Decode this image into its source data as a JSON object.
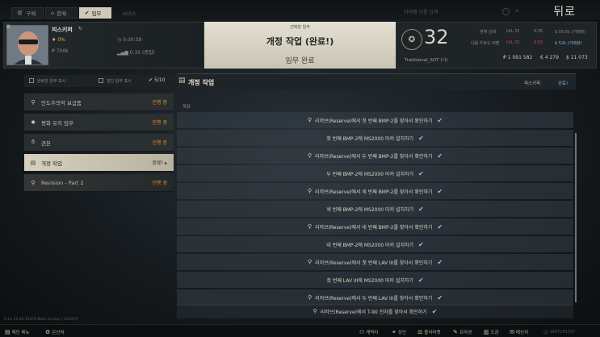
{
  "nav": {
    "tabs": [
      {
        "label": "구매",
        "icon": "cart-icon"
      },
      {
        "label": "판매",
        "icon": "tag-icon"
      },
      {
        "label": "임무",
        "icon": "check-icon"
      },
      {
        "label": "서비스",
        "icon": ""
      }
    ],
    "search_placeholder": "아이템 이름 검색",
    "back_label": "뒤로"
  },
  "profile": {
    "name": "피스키퍼",
    "standing": "0%",
    "spent": "₽ 700k",
    "time": "0:30:39",
    "rep": "0.35 (중립)"
  },
  "quest_header": {
    "selected_label": "선택한 임무",
    "title": "개정 작업 (완료!)",
    "status": "임무 완료"
  },
  "trader": {
    "level": "32",
    "name": "Traditional_SOT (나)",
    "current_label": "현재 상태",
    "next_label": "다음 우호도 레벨",
    "cur_lvl": "LVL 32",
    "cur_rep": "0.35",
    "cur_money": "$ 59.5k (거래량)",
    "next_lvl": "LVL 32",
    "next_rep": "0.59",
    "next_money": "$ 52k (거래량)",
    "rub": "₽ 1 091 582",
    "eur": "€ 4 279",
    "usd": "$ 11 073"
  },
  "filters": {
    "completed": "완료한 임무 표시",
    "locked": "잠긴 임무 표시",
    "count": "5/10"
  },
  "quests": [
    {
      "label": "인도주의적 보급품",
      "state": "진행 중",
      "icon": "pin-icon"
    },
    {
      "label": "평화 유지 임무",
      "state": "진행 중",
      "icon": "medal-icon"
    },
    {
      "label": "견본",
      "state": "진행 중",
      "icon": "hand-icon"
    },
    {
      "label": "개정 작업",
      "state": "완료! ▸",
      "icon": "document-icon"
    },
    {
      "label": "Revision - Part 2",
      "state": "진행 중",
      "icon": "magnifier-icon"
    }
  ],
  "detail": {
    "title": "개정 작업",
    "trader_label": "피스키퍼",
    "done_label": "완료!",
    "objectives_label": "목표"
  },
  "objectives": [
    {
      "text": "리저브(Reserve)에서 첫 번째 BMP-2를 찾아서 확인하기",
      "search": true
    },
    {
      "text": "첫 번째 BMP-2에 MS2000 마커 설치하기",
      "search": false
    },
    {
      "text": "리저브(Reserve)에서 두 번째 BMP-2를 찾아서 확인하기",
      "search": true
    },
    {
      "text": "두 번째 BMP-2에 MS2000 마커 설치하기",
      "search": false
    },
    {
      "text": "리저브(Reserve)에서 세 번째 BMP-2를 찾아서 확인하기",
      "search": true
    },
    {
      "text": "세 번째 BMP-2에 MS2000 마커 설치하기",
      "search": false
    },
    {
      "text": "리저브(Reserve)에서 네 번째 BMP-2를 찾아서 확인하기",
      "search": true
    },
    {
      "text": "네 번째 BMP-2에 MS2000 마커 설치하기",
      "search": false
    },
    {
      "text": "리저브(Reserve)에서 첫 번째 LAV III를 찾아서 확인하기",
      "search": true
    },
    {
      "text": "첫 번째 LAV III에 MS2000 마커 설치하기",
      "search": false
    },
    {
      "text": "리저브(Reserve)에서 두 번째 LAV III를 찾아서 확인하기",
      "search": true
    },
    {
      "text": "리저브(Reserve)에서 T-90 전차를 찾아서 확인하기",
      "search": true
    }
  ],
  "footer": {
    "version": "0.12.12.30.15870 Beta version | UE3475",
    "left": [
      {
        "label": "메인 메뉴",
        "icon": "menu-icon"
      },
      {
        "label": "은신처",
        "icon": "gear-icon"
      }
    ],
    "right": [
      {
        "label": "캐릭터",
        "icon": "person-icon"
      },
      {
        "label": "상인",
        "icon": "handshake-icon"
      },
      {
        "label": "플리마켓",
        "icon": "market-icon"
      },
      {
        "label": "프리셋",
        "icon": "preset-icon"
      },
      {
        "label": "도감",
        "icon": "book-icon"
      },
      {
        "label": "메신저",
        "icon": "mail-icon"
      },
      {
        "label": "WATCHLIST",
        "icon": "watch-icon"
      }
    ]
  }
}
